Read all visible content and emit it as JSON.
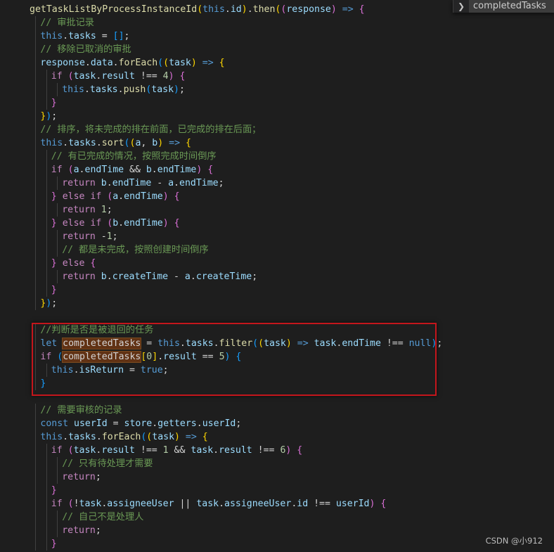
{
  "find_widget": {
    "toggle_icon": "chevron-right-icon",
    "query": "completedTasks"
  },
  "watermark": "CSDN @小912",
  "highlight": {
    "color": "#c4161c"
  },
  "code_lines": [
    {
      "indent": 0,
      "tokens": [
        [
          "fn",
          "getTaskListByProcessInstanceId"
        ],
        [
          "b1",
          "("
        ],
        [
          "kw",
          "this"
        ],
        [
          "op",
          "."
        ],
        [
          "var",
          "id"
        ],
        [
          "b1",
          ")"
        ],
        [
          "op",
          "."
        ],
        [
          "fn",
          "then"
        ],
        [
          "b1",
          "("
        ],
        [
          "b2",
          "("
        ],
        [
          "var",
          "response"
        ],
        [
          "b2",
          ")"
        ],
        [
          "op",
          " "
        ],
        [
          "kw",
          "=>"
        ],
        [
          "op",
          " "
        ],
        [
          "b2",
          "{"
        ]
      ]
    },
    {
      "indent": 1,
      "tokens": [
        [
          "cmt",
          "// 审批记录"
        ]
      ]
    },
    {
      "indent": 1,
      "tokens": [
        [
          "kw",
          "this"
        ],
        [
          "op",
          "."
        ],
        [
          "var",
          "tasks"
        ],
        [
          "op",
          " = "
        ],
        [
          "b3",
          "[]"
        ],
        [
          "op",
          ";"
        ]
      ]
    },
    {
      "indent": 1,
      "tokens": [
        [
          "cmt",
          "// 移除已取消的审批"
        ]
      ]
    },
    {
      "indent": 1,
      "tokens": [
        [
          "var",
          "response"
        ],
        [
          "op",
          "."
        ],
        [
          "var",
          "data"
        ],
        [
          "op",
          "."
        ],
        [
          "fn",
          "forEach"
        ],
        [
          "b3",
          "("
        ],
        [
          "b1",
          "("
        ],
        [
          "var",
          "task"
        ],
        [
          "b1",
          ")"
        ],
        [
          "op",
          " "
        ],
        [
          "kw",
          "=>"
        ],
        [
          "op",
          " "
        ],
        [
          "b1",
          "{"
        ]
      ]
    },
    {
      "indent": 2,
      "tokens": [
        [
          "ctl",
          "if"
        ],
        [
          "op",
          " "
        ],
        [
          "b2",
          "("
        ],
        [
          "var",
          "task"
        ],
        [
          "op",
          "."
        ],
        [
          "var",
          "result"
        ],
        [
          "op",
          " !== "
        ],
        [
          "num",
          "4"
        ],
        [
          "b2",
          ")"
        ],
        [
          "op",
          " "
        ],
        [
          "b2",
          "{"
        ]
      ]
    },
    {
      "indent": 3,
      "tokens": [
        [
          "kw",
          "this"
        ],
        [
          "op",
          "."
        ],
        [
          "var",
          "tasks"
        ],
        [
          "op",
          "."
        ],
        [
          "fn",
          "push"
        ],
        [
          "b3",
          "("
        ],
        [
          "var",
          "task"
        ],
        [
          "b3",
          ")"
        ],
        [
          "op",
          ";"
        ]
      ]
    },
    {
      "indent": 2,
      "tokens": [
        [
          "b2",
          "}"
        ]
      ]
    },
    {
      "indent": 1,
      "tokens": [
        [
          "b1",
          "}"
        ],
        [
          "b3",
          ")"
        ],
        [
          "op",
          ";"
        ]
      ]
    },
    {
      "indent": 1,
      "tokens": [
        [
          "cmt",
          "// 排序，将未完成的排在前面，已完成的排在后面；"
        ]
      ]
    },
    {
      "indent": 1,
      "tokens": [
        [
          "kw",
          "this"
        ],
        [
          "op",
          "."
        ],
        [
          "var",
          "tasks"
        ],
        [
          "op",
          "."
        ],
        [
          "fn",
          "sort"
        ],
        [
          "b3",
          "("
        ],
        [
          "b1",
          "("
        ],
        [
          "var",
          "a"
        ],
        [
          "op",
          ", "
        ],
        [
          "var",
          "b"
        ],
        [
          "b1",
          ")"
        ],
        [
          "op",
          " "
        ],
        [
          "kw",
          "=>"
        ],
        [
          "op",
          " "
        ],
        [
          "b1",
          "{"
        ]
      ]
    },
    {
      "indent": 2,
      "tokens": [
        [
          "cmt",
          "// 有已完成的情况，按照完成时间倒序"
        ]
      ]
    },
    {
      "indent": 2,
      "tokens": [
        [
          "ctl",
          "if"
        ],
        [
          "op",
          " "
        ],
        [
          "b2",
          "("
        ],
        [
          "var",
          "a"
        ],
        [
          "op",
          "."
        ],
        [
          "var",
          "endTime"
        ],
        [
          "op",
          " && "
        ],
        [
          "var",
          "b"
        ],
        [
          "op",
          "."
        ],
        [
          "var",
          "endTime"
        ],
        [
          "b2",
          ")"
        ],
        [
          "op",
          " "
        ],
        [
          "b2",
          "{"
        ]
      ]
    },
    {
      "indent": 3,
      "tokens": [
        [
          "ctl",
          "return"
        ],
        [
          "op",
          " "
        ],
        [
          "var",
          "b"
        ],
        [
          "op",
          "."
        ],
        [
          "var",
          "endTime"
        ],
        [
          "op",
          " - "
        ],
        [
          "var",
          "a"
        ],
        [
          "op",
          "."
        ],
        [
          "var",
          "endTime"
        ],
        [
          "op",
          ";"
        ]
      ]
    },
    {
      "indent": 2,
      "tokens": [
        [
          "b2",
          "}"
        ],
        [
          "op",
          " "
        ],
        [
          "ctl",
          "else"
        ],
        [
          "op",
          " "
        ],
        [
          "ctl",
          "if"
        ],
        [
          "op",
          " "
        ],
        [
          "b2",
          "("
        ],
        [
          "var",
          "a"
        ],
        [
          "op",
          "."
        ],
        [
          "var",
          "endTime"
        ],
        [
          "b2",
          ")"
        ],
        [
          "op",
          " "
        ],
        [
          "b2",
          "{"
        ]
      ]
    },
    {
      "indent": 3,
      "tokens": [
        [
          "ctl",
          "return"
        ],
        [
          "op",
          " "
        ],
        [
          "num",
          "1"
        ],
        [
          "op",
          ";"
        ]
      ]
    },
    {
      "indent": 2,
      "tokens": [
        [
          "b2",
          "}"
        ],
        [
          "op",
          " "
        ],
        [
          "ctl",
          "else"
        ],
        [
          "op",
          " "
        ],
        [
          "ctl",
          "if"
        ],
        [
          "op",
          " "
        ],
        [
          "b2",
          "("
        ],
        [
          "var",
          "b"
        ],
        [
          "op",
          "."
        ],
        [
          "var",
          "endTime"
        ],
        [
          "b2",
          ")"
        ],
        [
          "op",
          " "
        ],
        [
          "b2",
          "{"
        ]
      ]
    },
    {
      "indent": 3,
      "tokens": [
        [
          "ctl",
          "return"
        ],
        [
          "op",
          " -"
        ],
        [
          "num",
          "1"
        ],
        [
          "op",
          ";"
        ]
      ]
    },
    {
      "indent": 3,
      "tokens": [
        [
          "cmt",
          "// 都是未完成，按照创建时间倒序"
        ]
      ]
    },
    {
      "indent": 2,
      "tokens": [
        [
          "b2",
          "}"
        ],
        [
          "op",
          " "
        ],
        [
          "ctl",
          "else"
        ],
        [
          "op",
          " "
        ],
        [
          "b2",
          "{"
        ]
      ]
    },
    {
      "indent": 3,
      "tokens": [
        [
          "ctl",
          "return"
        ],
        [
          "op",
          " "
        ],
        [
          "var",
          "b"
        ],
        [
          "op",
          "."
        ],
        [
          "var",
          "createTime"
        ],
        [
          "op",
          " - "
        ],
        [
          "var",
          "a"
        ],
        [
          "op",
          "."
        ],
        [
          "var",
          "createTime"
        ],
        [
          "op",
          ";"
        ]
      ]
    },
    {
      "indent": 2,
      "tokens": [
        [
          "b2",
          "}"
        ]
      ]
    },
    {
      "indent": 1,
      "tokens": [
        [
          "b1",
          "}"
        ],
        [
          "b3",
          ")"
        ],
        [
          "op",
          ";"
        ]
      ]
    },
    {
      "indent": 0,
      "tokens": []
    },
    {
      "indent": 1,
      "tokens": [
        [
          "cmt",
          "//判断是否是被退回的任务"
        ]
      ]
    },
    {
      "indent": 1,
      "tokens": [
        [
          "kw",
          "let"
        ],
        [
          "op",
          " "
        ],
        [
          "hl",
          "completedTasks"
        ],
        [
          "op",
          " = "
        ],
        [
          "kw",
          "this"
        ],
        [
          "op",
          "."
        ],
        [
          "var",
          "tasks"
        ],
        [
          "op",
          "."
        ],
        [
          "fn",
          "filter"
        ],
        [
          "b3",
          "("
        ],
        [
          "b1",
          "("
        ],
        [
          "var",
          "task"
        ],
        [
          "b1",
          ")"
        ],
        [
          "op",
          " "
        ],
        [
          "kw",
          "=>"
        ],
        [
          "op",
          " "
        ],
        [
          "var",
          "task"
        ],
        [
          "op",
          "."
        ],
        [
          "var",
          "endTime"
        ],
        [
          "op",
          " !== "
        ],
        [
          "kw",
          "null"
        ],
        [
          "b3",
          ")"
        ],
        [
          "op",
          ";"
        ]
      ]
    },
    {
      "indent": 1,
      "tokens": [
        [
          "ctl",
          "if"
        ],
        [
          "op",
          " "
        ],
        [
          "b3",
          "("
        ],
        [
          "hl",
          "completedTasks"
        ],
        [
          "b1",
          "["
        ],
        [
          "num",
          "0"
        ],
        [
          "b1",
          "]"
        ],
        [
          "op",
          "."
        ],
        [
          "var",
          "result"
        ],
        [
          "op",
          " == "
        ],
        [
          "num",
          "5"
        ],
        [
          "b3",
          ")"
        ],
        [
          "op",
          " "
        ],
        [
          "b3",
          "{"
        ]
      ]
    },
    {
      "indent": 2,
      "tokens": [
        [
          "kw",
          "this"
        ],
        [
          "op",
          "."
        ],
        [
          "var",
          "isReturn"
        ],
        [
          "op",
          " = "
        ],
        [
          "kw",
          "true"
        ],
        [
          "op",
          ";"
        ]
      ]
    },
    {
      "indent": 1,
      "tokens": [
        [
          "b3",
          "}"
        ]
      ]
    },
    {
      "indent": 0,
      "tokens": []
    },
    {
      "indent": 1,
      "tokens": [
        [
          "cmt",
          "// 需要审核的记录"
        ]
      ]
    },
    {
      "indent": 1,
      "tokens": [
        [
          "kw",
          "const"
        ],
        [
          "op",
          " "
        ],
        [
          "var",
          "userId"
        ],
        [
          "op",
          " = "
        ],
        [
          "var",
          "store"
        ],
        [
          "op",
          "."
        ],
        [
          "var",
          "getters"
        ],
        [
          "op",
          "."
        ],
        [
          "var",
          "userId"
        ],
        [
          "op",
          ";"
        ]
      ]
    },
    {
      "indent": 1,
      "tokens": [
        [
          "kw",
          "this"
        ],
        [
          "op",
          "."
        ],
        [
          "var",
          "tasks"
        ],
        [
          "op",
          "."
        ],
        [
          "fn",
          "forEach"
        ],
        [
          "b3",
          "("
        ],
        [
          "b1",
          "("
        ],
        [
          "var",
          "task"
        ],
        [
          "b1",
          ")"
        ],
        [
          "op",
          " "
        ],
        [
          "kw",
          "=>"
        ],
        [
          "op",
          " "
        ],
        [
          "b1",
          "{"
        ]
      ]
    },
    {
      "indent": 2,
      "tokens": [
        [
          "ctl",
          "if"
        ],
        [
          "op",
          " "
        ],
        [
          "b2",
          "("
        ],
        [
          "var",
          "task"
        ],
        [
          "op",
          "."
        ],
        [
          "var",
          "result"
        ],
        [
          "op",
          " !== "
        ],
        [
          "num",
          "1"
        ],
        [
          "op",
          " && "
        ],
        [
          "var",
          "task"
        ],
        [
          "op",
          "."
        ],
        [
          "var",
          "result"
        ],
        [
          "op",
          " !== "
        ],
        [
          "num",
          "6"
        ],
        [
          "b2",
          ")"
        ],
        [
          "op",
          " "
        ],
        [
          "b2",
          "{"
        ]
      ]
    },
    {
      "indent": 3,
      "tokens": [
        [
          "cmt",
          "// 只有待处理才需要"
        ]
      ]
    },
    {
      "indent": 3,
      "tokens": [
        [
          "ctl",
          "return"
        ],
        [
          "op",
          ";"
        ]
      ]
    },
    {
      "indent": 2,
      "tokens": [
        [
          "b2",
          "}"
        ]
      ]
    },
    {
      "indent": 2,
      "tokens": [
        [
          "ctl",
          "if"
        ],
        [
          "op",
          " "
        ],
        [
          "b2",
          "("
        ],
        [
          "op",
          "!"
        ],
        [
          "var",
          "task"
        ],
        [
          "op",
          "."
        ],
        [
          "var",
          "assigneeUser"
        ],
        [
          "op",
          " || "
        ],
        [
          "var",
          "task"
        ],
        [
          "op",
          "."
        ],
        [
          "var",
          "assigneeUser"
        ],
        [
          "op",
          "."
        ],
        [
          "var",
          "id"
        ],
        [
          "op",
          " !== "
        ],
        [
          "var",
          "userId"
        ],
        [
          "b2",
          ")"
        ],
        [
          "op",
          " "
        ],
        [
          "b2",
          "{"
        ]
      ]
    },
    {
      "indent": 3,
      "tokens": [
        [
          "cmt",
          "// 自己不是处理人"
        ]
      ]
    },
    {
      "indent": 3,
      "tokens": [
        [
          "ctl",
          "return"
        ],
        [
          "op",
          ";"
        ]
      ]
    },
    {
      "indent": 2,
      "tokens": [
        [
          "b2",
          "}"
        ]
      ]
    }
  ]
}
